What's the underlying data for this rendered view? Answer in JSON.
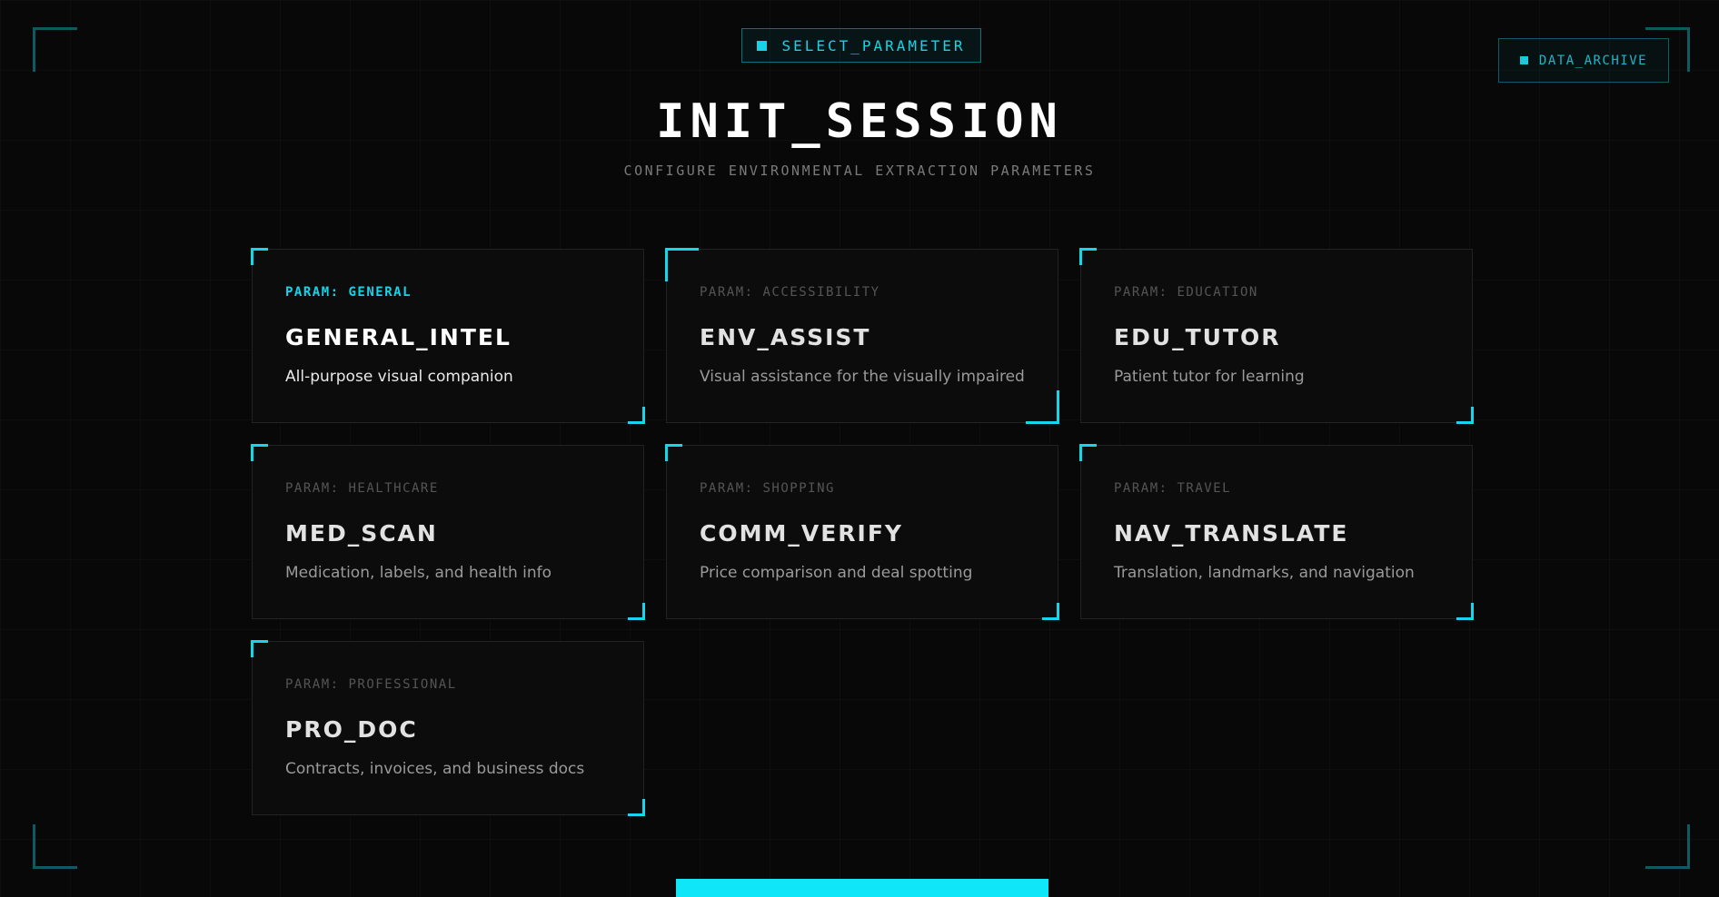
{
  "header": {
    "badge_label": "SELECT_PARAMETER",
    "title": "INIT_SESSION",
    "subtitle": "CONFIGURE ENVIRONMENTAL EXTRACTION PARAMETERS",
    "archive_label": "DATA_ARCHIVE"
  },
  "cards": [
    {
      "param": "PARAM: GENERAL",
      "name": "GENERAL_INTEL",
      "desc": "All-purpose visual companion",
      "selected": true
    },
    {
      "param": "PARAM: ACCESSIBILITY",
      "name": "ENV_ASSIST",
      "desc": "Visual assistance for the visually impaired",
      "selected": false
    },
    {
      "param": "PARAM: EDUCATION",
      "name": "EDU_TUTOR",
      "desc": "Patient tutor for learning",
      "selected": false
    },
    {
      "param": "PARAM: HEALTHCARE",
      "name": "MED_SCAN",
      "desc": "Medication, labels, and health info",
      "selected": false
    },
    {
      "param": "PARAM: SHOPPING",
      "name": "COMM_VERIFY",
      "desc": "Price comparison and deal spotting",
      "selected": false
    },
    {
      "param": "PARAM: TRAVEL",
      "name": "NAV_TRANSLATE",
      "desc": "Translation, landmarks, and navigation",
      "selected": false
    },
    {
      "param": "PARAM: PROFESSIONAL",
      "name": "PRO_DOC",
      "desc": "Contracts, invoices, and business docs",
      "selected": false
    }
  ],
  "colors": {
    "accent": "#17d3e6",
    "background": "#080808",
    "card_bg": "#0c0c0c",
    "card_border": "#222222",
    "muted_text": "#555555"
  }
}
